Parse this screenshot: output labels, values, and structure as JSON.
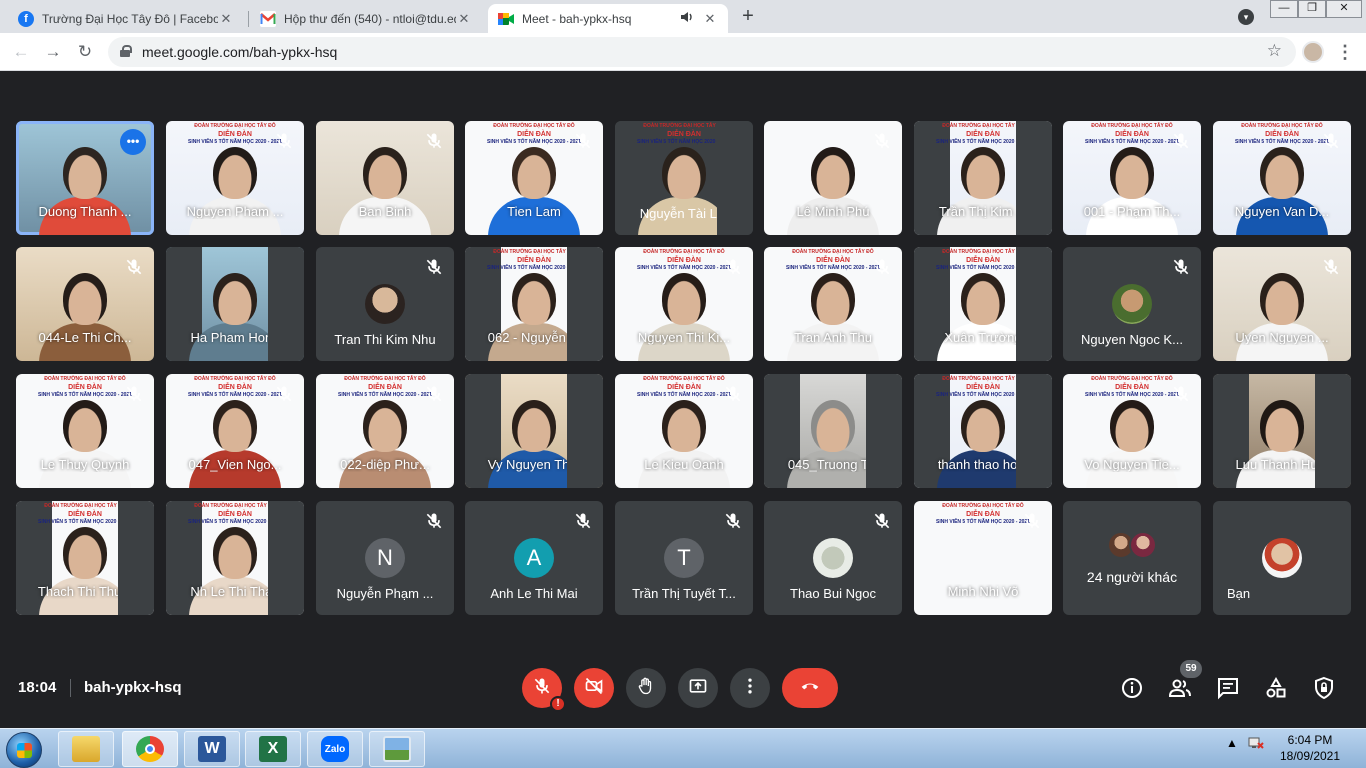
{
  "browser": {
    "tabs": [
      {
        "title": "Trường Đại Học Tây Đô | Facebook",
        "favicon": "facebook-icon",
        "active": false
      },
      {
        "title": "Hộp thư đến (540) - ntloi@tdu.edu.vn",
        "favicon": "gmail-icon",
        "active": false
      },
      {
        "title": "Meet - bah-ypkx-hsq",
        "favicon": "meet-icon",
        "active": true
      }
    ],
    "new_tab_label": "+",
    "close_label": "✕",
    "url": "meet.google.com/bah-ypkx-hsq",
    "window_controls": [
      "—",
      "❐",
      "✕"
    ]
  },
  "meeting": {
    "time": "18:04",
    "code": "bah-ypkx-hsq",
    "participant_count": "59",
    "banner": {
      "line1": "ĐOÀN TRƯỜNG ĐẠI HỌC TÂY ĐÔ",
      "line2": "DIỄN ĐÀN",
      "line3": "SINH VIÊN 5 TỐT NĂM HỌC 2020 - 2021"
    },
    "tiles": [
      {
        "name": "Duong Thanh ...",
        "pinned": true
      },
      {
        "name": "Nguyen Pham ..."
      },
      {
        "name": "Ban Binh"
      },
      {
        "name": "Tien Lam"
      },
      {
        "name": "Nguyễn Tài Lợi"
      },
      {
        "name": "Lê Minh Phú"
      },
      {
        "name": "Trần Thị Kim ..."
      },
      {
        "name": "001 - Phạm Th..."
      },
      {
        "name": "Nguyen Van D..."
      },
      {
        "name": "044-Le Thi Ch..."
      },
      {
        "name": "Ha Pham Hong"
      },
      {
        "name": "Tran Thi Kim Nhu"
      },
      {
        "name": "062 - Nguyễn ..."
      },
      {
        "name": "Nguyen Thi Ki..."
      },
      {
        "name": "Tran Anh Thu"
      },
      {
        "name": "Xuân Trường"
      },
      {
        "name": "Nguyen Ngoc K..."
      },
      {
        "name": "Uyen Nguyen ..."
      },
      {
        "name": "Le Thuy Quynh"
      },
      {
        "name": "047_Vien Ngo..."
      },
      {
        "name": "022-diệp Phư..."
      },
      {
        "name": "Vy Nguyen Th..."
      },
      {
        "name": "Le Kieu Oanh"
      },
      {
        "name": "045_Truong T..."
      },
      {
        "name": "thanh thao ho..."
      },
      {
        "name": "Vo Nguyen Tie..."
      },
      {
        "name": "Luu Thanh Hu..."
      },
      {
        "name": "Thach Thi Thu..."
      },
      {
        "name": "Nh Le Thi Thao"
      },
      {
        "name": "Nguyễn Phạm ...",
        "initial": "N"
      },
      {
        "name": "Anh Le Thi Mai",
        "initial": "A"
      },
      {
        "name": "Trần Thị Tuyết T...",
        "initial": "T"
      },
      {
        "name": "Thao Bui Ngoc"
      },
      {
        "name": "Minh Nhi Võ"
      },
      {
        "name": "24 người khác"
      },
      {
        "name": "Bạn"
      }
    ]
  },
  "taskbar": {
    "apps": [
      "file-explorer-icon",
      "chrome-icon",
      "word-icon",
      "excel-icon",
      "zalo-icon",
      "photo-viewer-icon"
    ],
    "zalo_label": "Zalo",
    "word_letter": "W",
    "excel_letter": "X",
    "clock_time": "6:04 PM",
    "clock_date": "18/09/2021"
  },
  "colors": {
    "meet_bg": "#202124",
    "tile_bg": "#3c4043",
    "hangup_red": "#ea4335",
    "pinned_outline": "#8ab4f8"
  }
}
